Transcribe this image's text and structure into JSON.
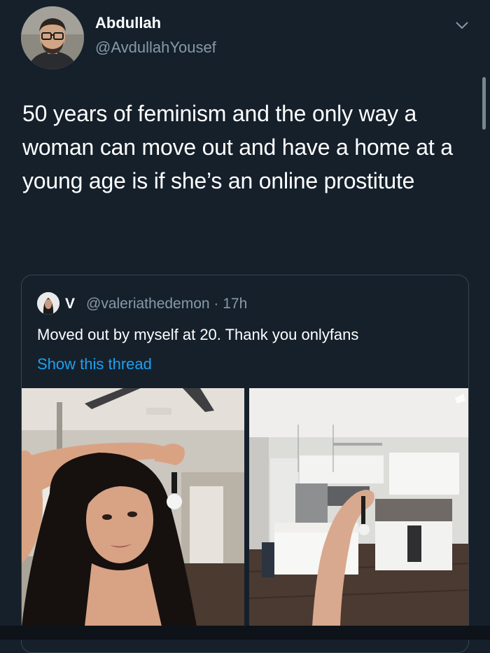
{
  "author": {
    "name": "Abdullah",
    "handle": "@AvdullahYousef"
  },
  "tweet": {
    "text": "50 years of feminism and the only way a woman can move out and have a home at a young age is if she’s an online prostitute"
  },
  "quoted": {
    "name": "V",
    "handle_time": "@valeriathedemon · 17h",
    "text": "Moved out by myself at 20. Thank you onlyfans",
    "link_label": "Show this thread"
  },
  "icons": {
    "menu": "chevron-down-icon"
  },
  "colors": {
    "background": "#15202b",
    "secondary_text": "#8899a6",
    "link": "#1da1f2",
    "card_border": "#38444d"
  }
}
